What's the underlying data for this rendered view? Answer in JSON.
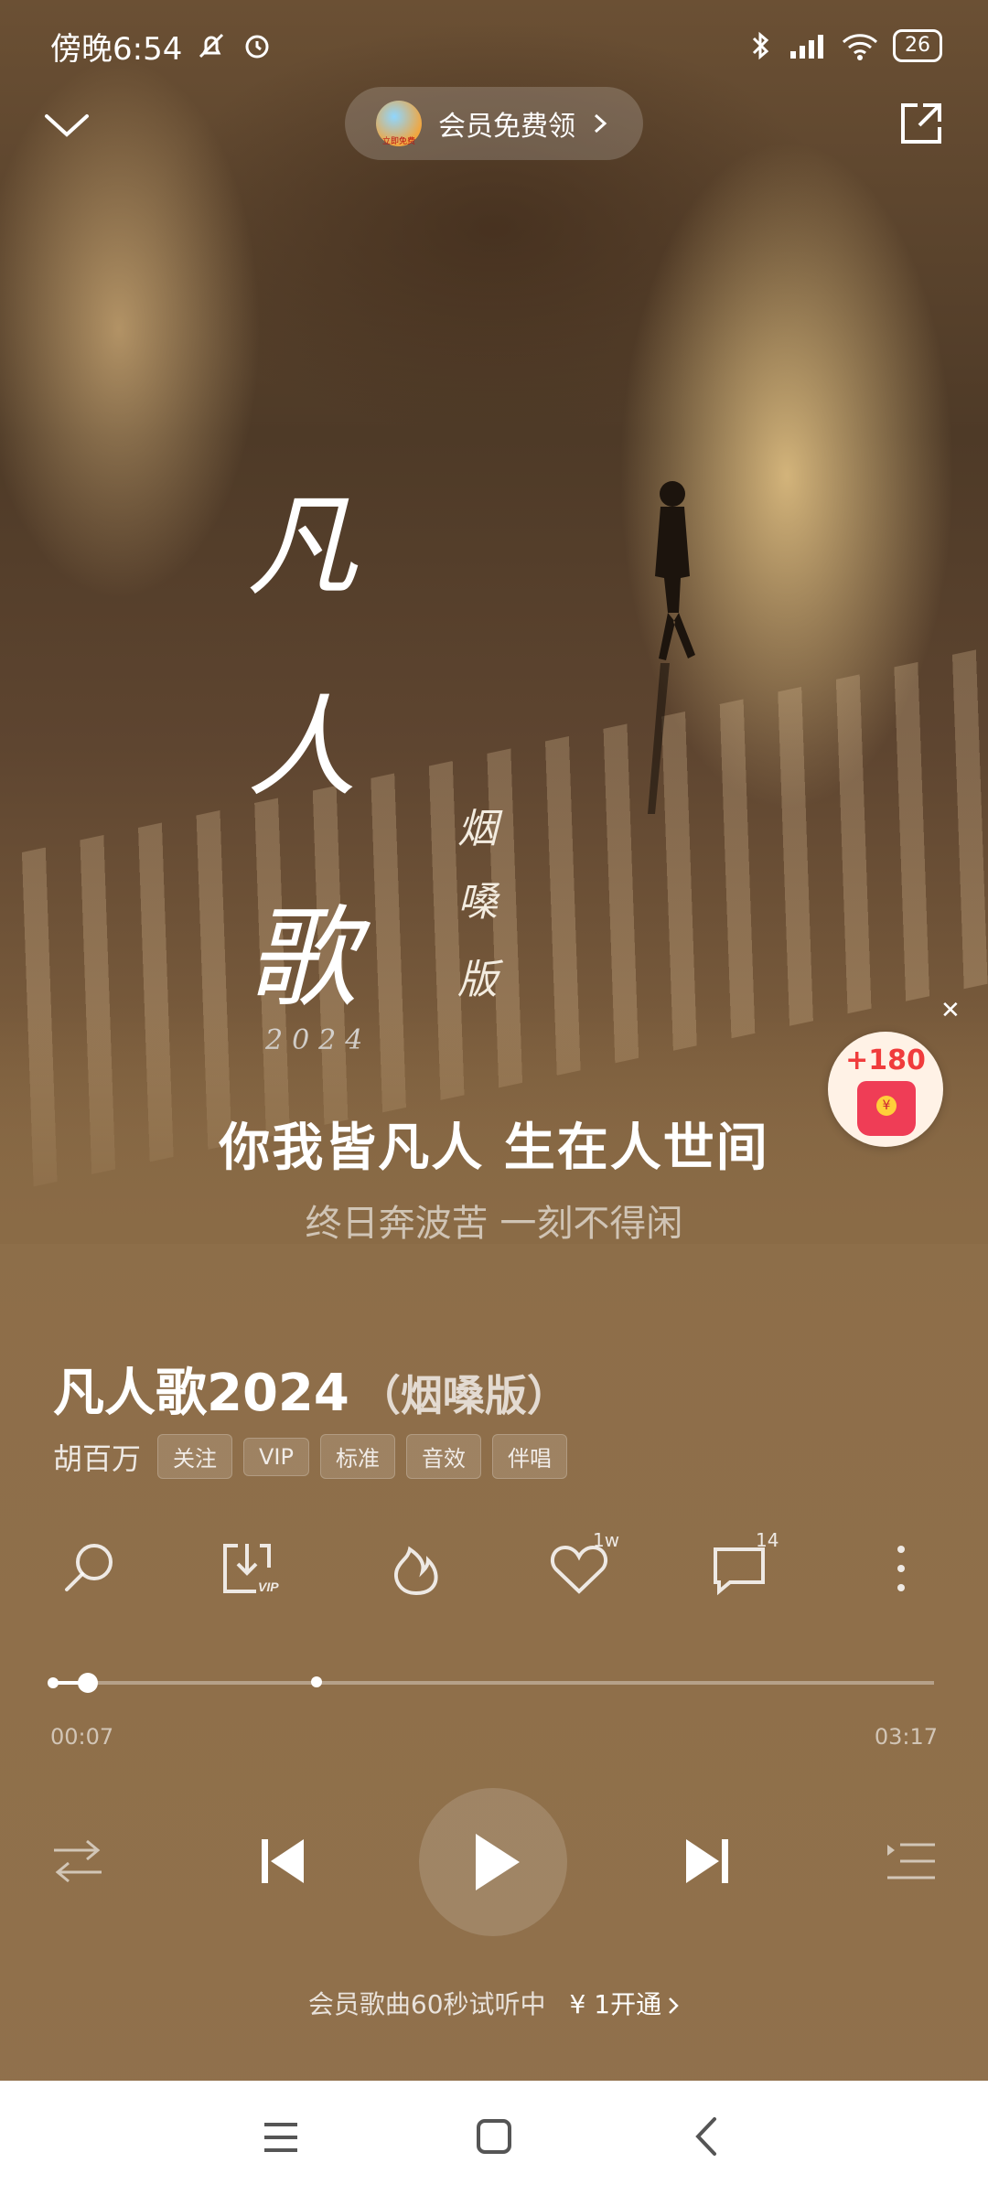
{
  "status_bar": {
    "time": "傍晚6:54",
    "battery": "26"
  },
  "top": {
    "vip_promo": "会员免费领",
    "vip_avatar_text": "立即免费"
  },
  "artwork": {
    "title_chars": [
      "凡",
      "人",
      "歌"
    ],
    "edition_chars": [
      "烟",
      "嗓",
      "版"
    ],
    "year": "2024"
  },
  "red_packet": {
    "amount": "+180",
    "coin": "¥"
  },
  "lyrics": {
    "current": "你我皆凡人 生在人世间",
    "next": "终日奔波苦 一刻不得闲"
  },
  "song": {
    "title": "凡人歌2024",
    "version": "（烟嗓版）",
    "artist": "胡百万",
    "tags": [
      "关注",
      "VIP",
      "标准",
      "音效",
      "伴唱"
    ]
  },
  "actions": {
    "like_count": "1w",
    "comment_count": "14"
  },
  "progress": {
    "elapsed": "00:07",
    "total": "03:17",
    "played_fraction": 0.04,
    "buffered_fraction": 0.3
  },
  "trial": {
    "message": "会员歌曲60秒试听中",
    "cta": "¥ 1开通"
  }
}
